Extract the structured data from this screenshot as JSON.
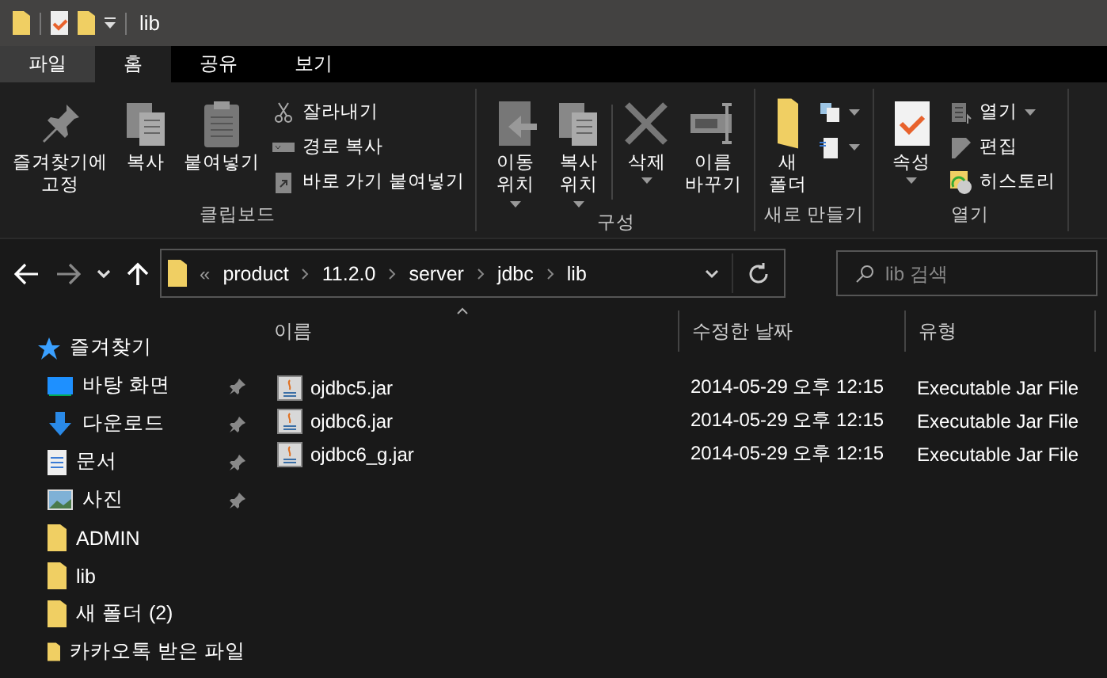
{
  "title_bar": {
    "title": "lib"
  },
  "tabs": [
    {
      "label": "파일",
      "selected": false,
      "kind": "file"
    },
    {
      "label": "홈",
      "selected": true,
      "kind": "tab"
    },
    {
      "label": "공유",
      "selected": false,
      "kind": "tab"
    },
    {
      "label": "보기",
      "selected": false,
      "kind": "tab"
    }
  ],
  "ribbon": {
    "groups": [
      {
        "label": "클립보드",
        "items": [
          {
            "kind": "large",
            "label": "즐겨찾기에\n고정",
            "dropdown": false
          },
          {
            "kind": "large",
            "label": "복사",
            "dropdown": false
          },
          {
            "kind": "large",
            "label": "붙여넣기",
            "dropdown": false
          },
          {
            "kind": "stack",
            "items": [
              {
                "label": "잘라내기",
                "dropdown": false
              },
              {
                "label": "경로 복사",
                "dropdown": false
              },
              {
                "label": "바로 가기 붙여넣기",
                "dropdown": false
              }
            ]
          }
        ]
      },
      {
        "label": "구성",
        "items": [
          {
            "kind": "large",
            "label": "이동\n위치",
            "dropdown": true
          },
          {
            "kind": "large",
            "label": "복사\n위치",
            "dropdown": true
          },
          {
            "kind": "separator"
          },
          {
            "kind": "large",
            "label": "삭제",
            "dropdown": true
          },
          {
            "kind": "large",
            "label": "이름\n바꾸기",
            "dropdown": false
          }
        ]
      },
      {
        "label": "새로 만들기",
        "items": [
          {
            "kind": "large",
            "label": "새\n폴더",
            "dropdown": false
          },
          {
            "kind": "stack",
            "items": [
              {
                "dropdown": true
              },
              {
                "dropdown": true
              }
            ]
          }
        ]
      },
      {
        "label": "열기",
        "items": [
          {
            "kind": "large",
            "label": "속성",
            "dropdown": true
          },
          {
            "kind": "stack",
            "items": [
              {
                "label": "열기",
                "dropdown": true
              },
              {
                "label": "편집",
                "dropdown": false
              },
              {
                "label": "히스토리",
                "dropdown": false
              }
            ]
          }
        ]
      }
    ]
  },
  "address_bar": {
    "overflow": "«",
    "crumbs": [
      "product",
      "11.2.0",
      "server",
      "jdbc",
      "lib"
    ]
  },
  "search": {
    "placeholder": "lib 검색"
  },
  "sidebar": {
    "header": "즐겨찾기",
    "items": [
      {
        "label": "바탕 화면",
        "kind": "desktop",
        "pinned": true
      },
      {
        "label": "다운로드",
        "kind": "download",
        "pinned": true
      },
      {
        "label": "문서",
        "kind": "document",
        "pinned": true
      },
      {
        "label": "사진",
        "kind": "pictures",
        "pinned": true
      },
      {
        "label": "ADMIN",
        "kind": "folder",
        "pinned": false
      },
      {
        "label": "lib",
        "kind": "folder",
        "pinned": false
      },
      {
        "label": "새 폴더 (2)",
        "kind": "folder",
        "pinned": false
      },
      {
        "label": "카카오톡 받은 파일",
        "kind": "folder",
        "pinned": false
      }
    ]
  },
  "table": {
    "columns": [
      "이름",
      "수정한 날짜",
      "유형"
    ],
    "rows": [
      {
        "name": "ojdbc5.jar",
        "modified": "2014-05-29 오후 12:15",
        "type": "Executable Jar File"
      },
      {
        "name": "ojdbc6.jar",
        "modified": "2014-05-29 오후 12:15",
        "type": "Executable Jar File"
      },
      {
        "name": "ojdbc6_g.jar",
        "modified": "2014-05-29 오후 12:15",
        "type": "Executable Jar File"
      }
    ]
  }
}
